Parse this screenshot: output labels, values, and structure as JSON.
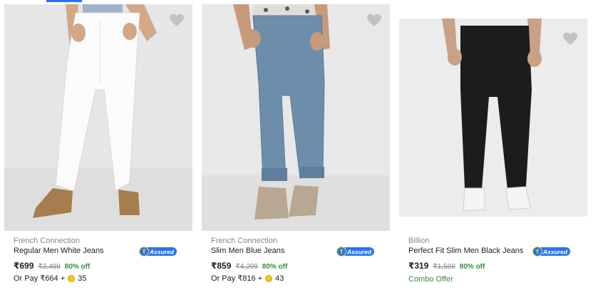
{
  "colors": {
    "accent": "#2874f0",
    "discount": "#388e3c",
    "muted": "#878787"
  },
  "products": [
    {
      "brand": "French Connection",
      "title": "Regular Men White Jeans",
      "price": "₹699",
      "mrp": "₹3,499",
      "discount": "80% off",
      "pay_prefix": "Or Pay ₹664 +",
      "pay_coins": "35",
      "assured_label": "Assured",
      "wishlist_icon": "heart-icon"
    },
    {
      "brand": "French Connection",
      "title": "Slim Men Blue Jeans",
      "price": "₹859",
      "mrp": "₹4,299",
      "discount": "80% off",
      "pay_prefix": "Or Pay ₹816 +",
      "pay_coins": "43",
      "assured_label": "Assured",
      "wishlist_icon": "heart-icon"
    },
    {
      "brand": "Billion",
      "title": "Perfect Fit Slim Men Black Jeans",
      "price": "₹319",
      "mrp": "₹1,599",
      "discount": "80% off",
      "offer": "Combo Offer",
      "assured_label": "Assured",
      "wishlist_icon": "heart-icon"
    }
  ]
}
